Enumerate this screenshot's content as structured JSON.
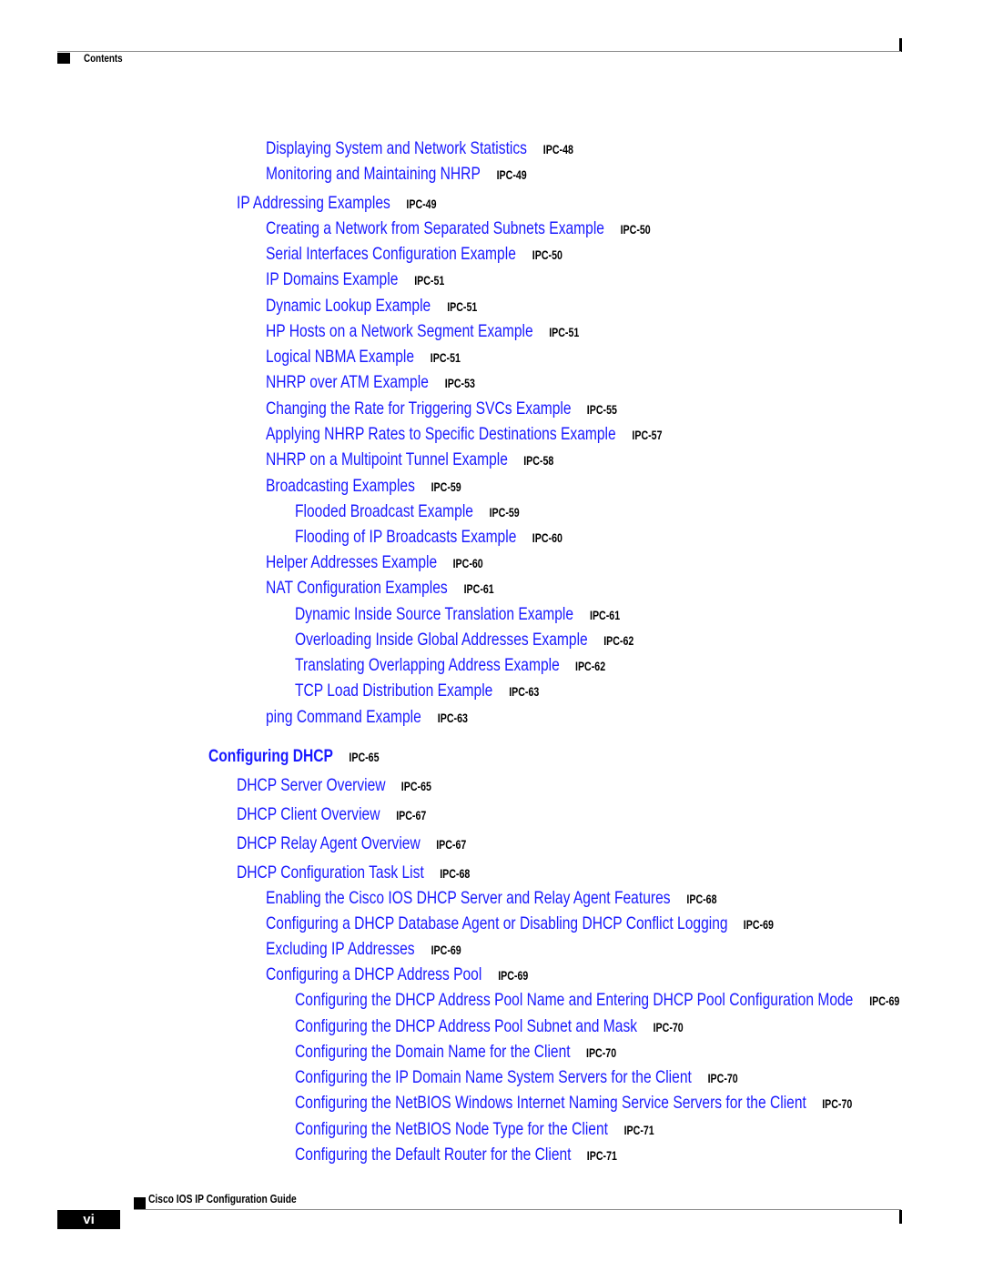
{
  "header": {
    "section_label": "Contents"
  },
  "toc": {
    "entries": [
      {
        "level": 2,
        "title": "Displaying System and Network Statistics",
        "page": "IPC-48"
      },
      {
        "level": 2,
        "title": "Monitoring and Maintaining NHRP",
        "page": "IPC-49"
      },
      {
        "level": 1,
        "title": "IP Addressing Examples",
        "page": "IPC-49"
      },
      {
        "level": 2,
        "title": "Creating a Network from Separated Subnets Example",
        "page": "IPC-50"
      },
      {
        "level": 2,
        "title": "Serial Interfaces Configuration Example",
        "page": "IPC-50"
      },
      {
        "level": 2,
        "title": "IP Domains Example",
        "page": "IPC-51"
      },
      {
        "level": 2,
        "title": "Dynamic Lookup Example",
        "page": "IPC-51"
      },
      {
        "level": 2,
        "title": "HP Hosts on a Network Segment Example",
        "page": "IPC-51"
      },
      {
        "level": 2,
        "title": "Logical NBMA Example",
        "page": "IPC-51"
      },
      {
        "level": 2,
        "title": "NHRP over ATM Example",
        "page": "IPC-53"
      },
      {
        "level": 2,
        "title": "Changing the Rate for Triggering SVCs Example",
        "page": "IPC-55"
      },
      {
        "level": 2,
        "title": "Applying NHRP Rates to Specific Destinations Example",
        "page": "IPC-57"
      },
      {
        "level": 2,
        "title": "NHRP on a Multipoint Tunnel Example",
        "page": "IPC-58"
      },
      {
        "level": 2,
        "title": "Broadcasting Examples",
        "page": "IPC-59"
      },
      {
        "level": 3,
        "title": "Flooded Broadcast Example",
        "page": "IPC-59"
      },
      {
        "level": 3,
        "title": "Flooding of IP Broadcasts Example",
        "page": "IPC-60"
      },
      {
        "level": 2,
        "title": "Helper Addresses Example",
        "page": "IPC-60"
      },
      {
        "level": 2,
        "title": "NAT Configuration Examples",
        "page": "IPC-61"
      },
      {
        "level": 3,
        "title": "Dynamic Inside Source Translation Example",
        "page": "IPC-61"
      },
      {
        "level": 3,
        "title": "Overloading Inside Global Addresses Example",
        "page": "IPC-62"
      },
      {
        "level": 3,
        "title": "Translating Overlapping Address Example",
        "page": "IPC-62"
      },
      {
        "level": 3,
        "title": "TCP Load Distribution Example",
        "page": "IPC-63"
      },
      {
        "level": 2,
        "title": "ping Command Example",
        "page": "IPC-63"
      },
      {
        "level": 0,
        "title": "Configuring DHCP",
        "page": "IPC-65"
      },
      {
        "level": 1,
        "title": "DHCP Server Overview",
        "page": "IPC-65"
      },
      {
        "level": 1,
        "title": "DHCP Client Overview",
        "page": "IPC-67"
      },
      {
        "level": 1,
        "title": "DHCP Relay Agent Overview",
        "page": "IPC-67"
      },
      {
        "level": 1,
        "title": "DHCP Configuration Task List",
        "page": "IPC-68"
      },
      {
        "level": 2,
        "title": "Enabling the Cisco IOS DHCP Server and Relay Agent Features",
        "page": "IPC-68"
      },
      {
        "level": 2,
        "title": "Configuring a DHCP Database Agent or Disabling DHCP Conflict Logging",
        "page": "IPC-69"
      },
      {
        "level": 2,
        "title": "Excluding IP Addresses",
        "page": "IPC-69"
      },
      {
        "level": 2,
        "title": "Configuring a DHCP Address Pool",
        "page": "IPC-69"
      },
      {
        "level": 3,
        "title": "Configuring the DHCP Address Pool Name and Entering DHCP Pool Configuration Mode",
        "page": "IPC-69"
      },
      {
        "level": 3,
        "title": "Configuring the DHCP Address Pool Subnet and Mask",
        "page": "IPC-70"
      },
      {
        "level": 3,
        "title": "Configuring the Domain Name for the Client",
        "page": "IPC-70"
      },
      {
        "level": 3,
        "title": "Configuring the IP Domain Name System Servers for the Client",
        "page": "IPC-70"
      },
      {
        "level": 3,
        "title": "Configuring the NetBIOS Windows Internet Naming Service Servers for the Client",
        "page": "IPC-70"
      },
      {
        "level": 3,
        "title": "Configuring the NetBIOS Node Type for the Client",
        "page": "IPC-71"
      },
      {
        "level": 3,
        "title": "Configuring the Default Router for the Client",
        "page": "IPC-71"
      }
    ]
  },
  "footer": {
    "book_title": "Cisco IOS IP Configuration Guide",
    "page_number": "vi"
  },
  "colors": {
    "link": "#1a1aff",
    "page_ref": "#000000"
  }
}
